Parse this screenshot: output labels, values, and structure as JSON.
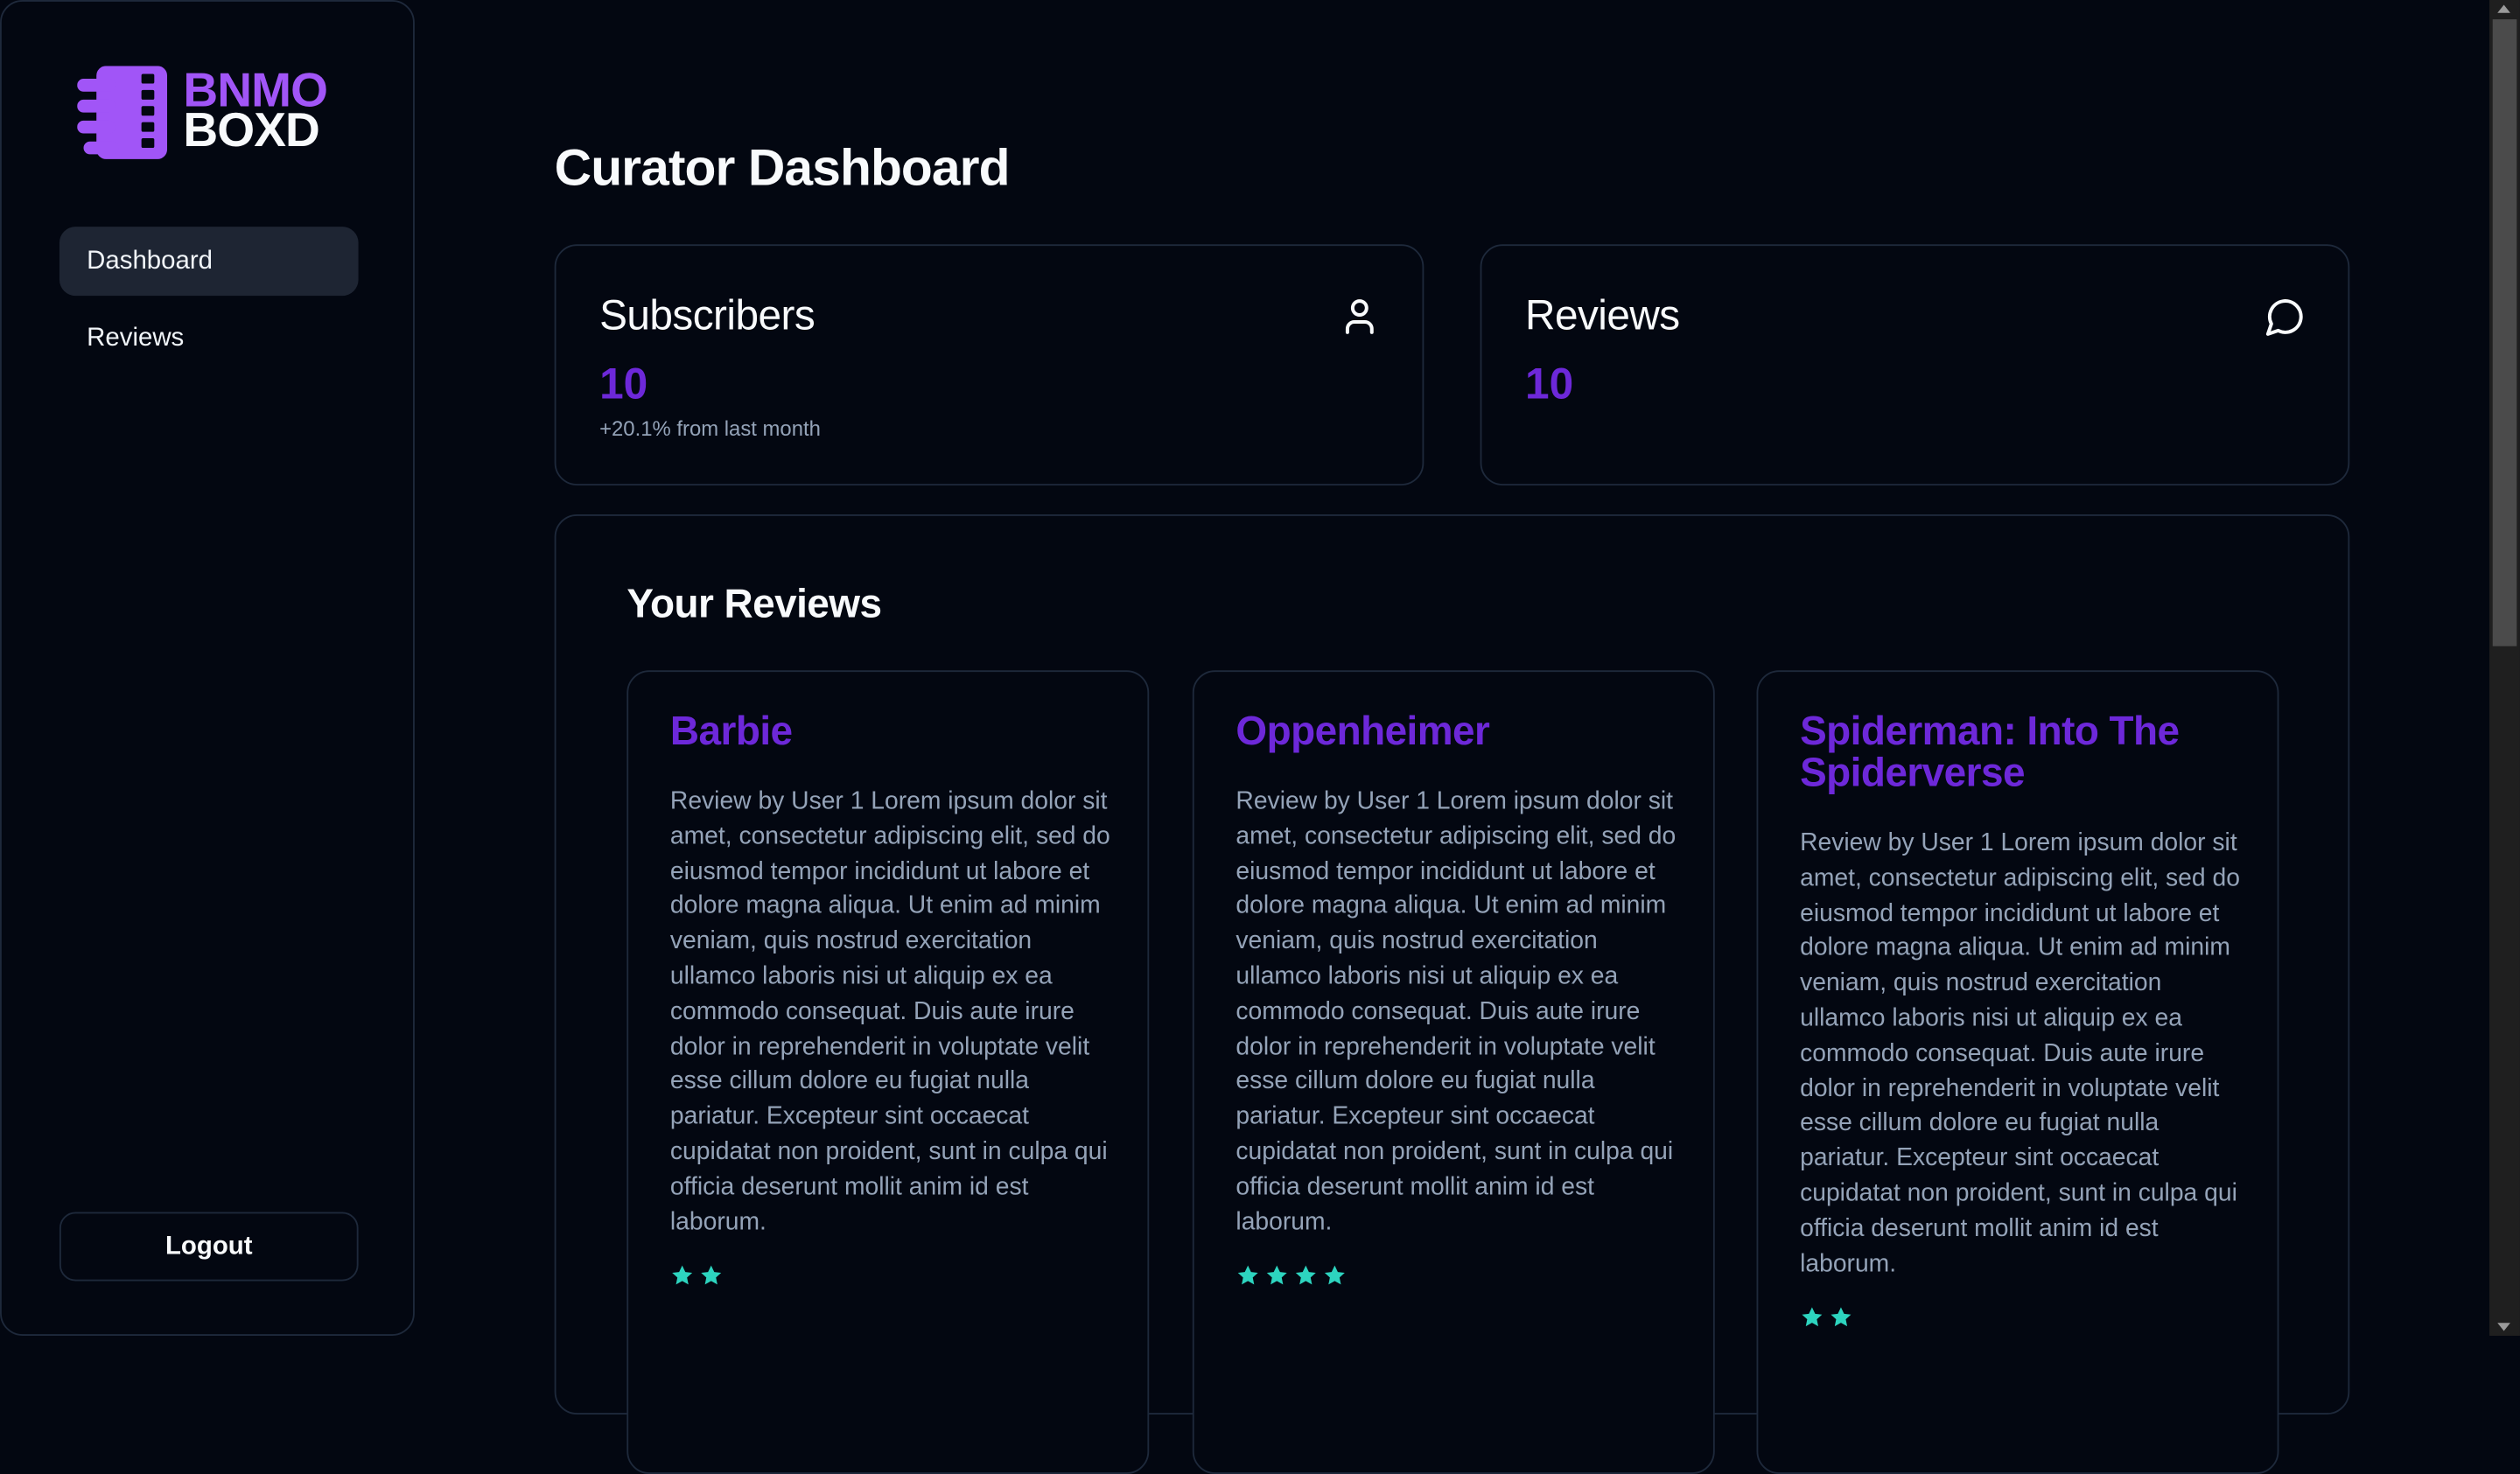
{
  "app": {
    "logo_top": "BNMO",
    "logo_bottom": "BOXD"
  },
  "sidebar": {
    "items": [
      {
        "label": "Dashboard",
        "active": true
      },
      {
        "label": "Reviews",
        "active": false
      }
    ],
    "logout_label": "Logout"
  },
  "page": {
    "title": "Curator Dashboard"
  },
  "stats": {
    "subscribers": {
      "title": "Subscribers",
      "value": "10",
      "change": "+20.1% from last month",
      "icon": "user-icon"
    },
    "reviews": {
      "title": "Reviews",
      "value": "10",
      "icon": "message-circle-icon"
    }
  },
  "your_reviews": {
    "title": "Your Reviews",
    "cards": [
      {
        "title": "Barbie",
        "body": "Review by User 1 Lorem ipsum dolor sit amet, consectetur adipiscing elit, sed do eiusmod tempor incididunt ut labore et dolore magna aliqua. Ut enim ad minim veniam, quis nostrud exercitation ullamco laboris nisi ut aliquip ex ea commodo consequat. Duis aute irure dolor in reprehenderit in voluptate velit esse cillum dolore eu fugiat nulla pariatur. Excepteur sint occaecat cupidatat non proident, sunt in culpa qui officia deserunt mollit anim id est laborum.",
        "stars": 2
      },
      {
        "title": "Oppenheimer",
        "body": "Review by User 1 Lorem ipsum dolor sit amet, consectetur adipiscing elit, sed do eiusmod tempor incididunt ut labore et dolore magna aliqua. Ut enim ad minim veniam, quis nostrud exercitation ullamco laboris nisi ut aliquip ex ea commodo consequat. Duis aute irure dolor in reprehenderit in voluptate velit esse cillum dolore eu fugiat nulla pariatur. Excepteur sint occaecat cupidatat non proident, sunt in culpa qui officia deserunt mollit anim id est laborum.",
        "stars": 4
      },
      {
        "title": "Spiderman: Into The Spiderverse",
        "body": "Review by User 1 Lorem ipsum dolor sit amet, consectetur adipiscing elit, sed do eiusmod tempor incididunt ut labore et dolore magna aliqua. Ut enim ad minim veniam, quis nostrud exercitation ullamco laboris nisi ut aliquip ex ea commodo consequat. Duis aute irure dolor in reprehenderit in voluptate velit esse cillum dolore eu fugiat nulla pariatur. Excepteur sint occaecat cupidatat non proident, sunt in culpa qui officia deserunt mollit anim id est laborum.",
        "stars": 2
      }
    ]
  },
  "colors": {
    "background": "#030711",
    "accent": "#6d28d9",
    "logo_accent": "#a155f7",
    "star": "#2dd4bf",
    "muted_text": "#94a3b8",
    "border": "#1e293b"
  }
}
